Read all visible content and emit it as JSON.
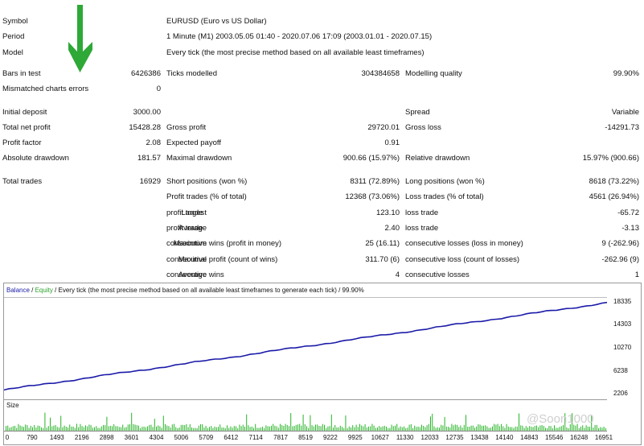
{
  "header": {
    "symbol": {
      "label": "Symbol",
      "value": "EURUSD (Euro vs US Dollar)"
    },
    "period": {
      "label": "Period",
      "value": "1 Minute (M1) 2003.05.05 01:40 - 2020.07.06 17:09 (2003.01.01 - 2020.07.15)"
    },
    "model": {
      "label": "Model",
      "value": "Every tick (the most precise method based on all available least timeframes)"
    }
  },
  "stats": {
    "bars_in_test": {
      "label": "Bars in test",
      "value": "6426386"
    },
    "ticks_modelled": {
      "label": "Ticks modelled",
      "value": "304384658"
    },
    "modelling_quality": {
      "label": "Modelling quality",
      "value": "99.90%"
    },
    "mismatched": {
      "label": "Mismatched charts errors",
      "value": "0"
    },
    "initial_deposit": {
      "label": "Initial deposit",
      "value": "3000.00"
    },
    "spread": {
      "label": "Spread",
      "value": "Variable"
    },
    "total_net_profit": {
      "label": "Total net profit",
      "value": "15428.28"
    },
    "gross_profit": {
      "label": "Gross profit",
      "value": "29720.01"
    },
    "gross_loss": {
      "label": "Gross loss",
      "value": "-14291.73"
    },
    "profit_factor": {
      "label": "Profit factor",
      "value": "2.08"
    },
    "expected_payoff": {
      "label": "Expected payoff",
      "value": "0.91"
    },
    "absolute_drawdown": {
      "label": "Absolute drawdown",
      "value": "181.57"
    },
    "maximal_drawdown": {
      "label": "Maximal drawdown",
      "value": "900.66 (15.97%)"
    },
    "relative_drawdown": {
      "label": "Relative drawdown",
      "value": "15.97% (900.66)"
    },
    "total_trades": {
      "label": "Total trades",
      "value": "16929"
    },
    "short_positions": {
      "label": "Short positions (won %)",
      "value": "8311 (72.89%)"
    },
    "long_positions": {
      "label": "Long positions (won %)",
      "value": "8618 (73.22%)"
    },
    "profit_trades": {
      "label": "Profit trades (% of total)",
      "value": "12368 (73.06%)"
    },
    "loss_trades": {
      "label": "Loss trades (% of total)",
      "value": "4561 (26.94%)"
    },
    "largest": {
      "prefix": "Largest",
      "profit_label": "profit trade",
      "profit_value": "123.10",
      "loss_label": "loss trade",
      "loss_value": "-65.72"
    },
    "average": {
      "prefix": "Average",
      "profit_label": "profit trade",
      "profit_value": "2.40",
      "loss_label": "loss trade",
      "loss_value": "-3.13"
    },
    "maximum": {
      "prefix": "Maximum",
      "wins_label": "consecutive wins (profit in money)",
      "wins_value": "25 (16.11)",
      "losses_label": "consecutive losses (loss in money)",
      "losses_value": "9 (-262.96)"
    },
    "maximal": {
      "prefix": "Maximal",
      "wins_label": "consecutive profit (count of wins)",
      "wins_value": "311.70 (6)",
      "losses_label": "consecutive loss (count of losses)",
      "losses_value": "-262.96 (9)"
    },
    "average2": {
      "prefix": "Average",
      "wins_label": "consecutive wins",
      "wins_value": "4",
      "losses_label": "consecutive losses",
      "losses_value": "1"
    }
  },
  "chart_header": {
    "balance": "Balance",
    "sep1": " / ",
    "equity": "Equity",
    "rest": " / Every tick (the most precise method based on all available least timeframes to generate each tick) / 99.90%"
  },
  "colors": {
    "balance": "#1a1aa8",
    "equity": "#2aa02a",
    "size": "#28b428",
    "arrow": "#2ea836"
  },
  "icons": {
    "arrow": "down-arrow-icon"
  },
  "chart_data": {
    "type": "line",
    "series": [
      {
        "name": "Balance",
        "x": [
          0,
          16951
        ],
        "y": [
          3000,
          18335
        ]
      }
    ],
    "yticks": [
      "18335",
      "14303",
      "10270",
      "6238",
      "2206"
    ],
    "ylim": [
      2206,
      18335
    ],
    "xticks": [
      "0",
      "790",
      "1493",
      "2196",
      "2898",
      "3601",
      "4304",
      "5006",
      "5709",
      "6412",
      "7114",
      "7817",
      "8519",
      "9222",
      "9925",
      "10627",
      "11330",
      "12033",
      "12735",
      "13438",
      "14140",
      "14843",
      "15546",
      "16248",
      "16951"
    ],
    "size_label": "Size"
  },
  "watermark": "@Soon1000"
}
